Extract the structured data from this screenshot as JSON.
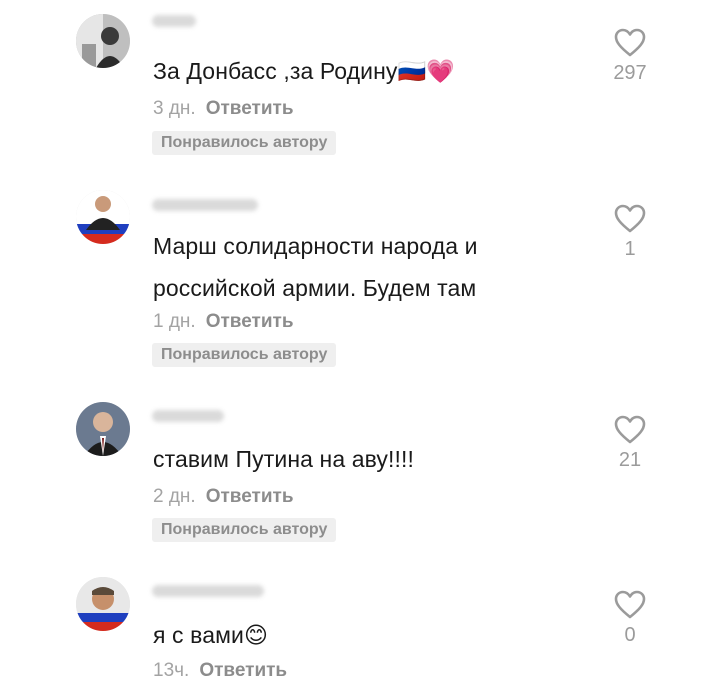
{
  "comments": [
    {
      "text": "За Донбасс ,за Родину🇷🇺💗",
      "time": "3 дн.",
      "reply": "Ответить",
      "badge": "Понравилось автору",
      "likes": "297"
    },
    {
      "text": "Марш солидарности народа и российской армии. Будем там",
      "time": "1 дн.",
      "reply": "Ответить",
      "badge": "Понравилось автору",
      "likes": "1"
    },
    {
      "text": "ставим Путина на аву!!!!",
      "time": "2 дн.",
      "reply": "Ответить",
      "badge": "Понравилось автору",
      "likes": "21"
    },
    {
      "text": "я с вами😊",
      "time": "13ч.",
      "reply": "Ответить",
      "likes": "0"
    }
  ],
  "icons": {
    "like": "heart-outline-icon"
  },
  "colors": {
    "text": "#1a1a1a",
    "meta": "#a3a3a3",
    "badge_bg": "#efefef",
    "heart": "#9b9b9b"
  }
}
